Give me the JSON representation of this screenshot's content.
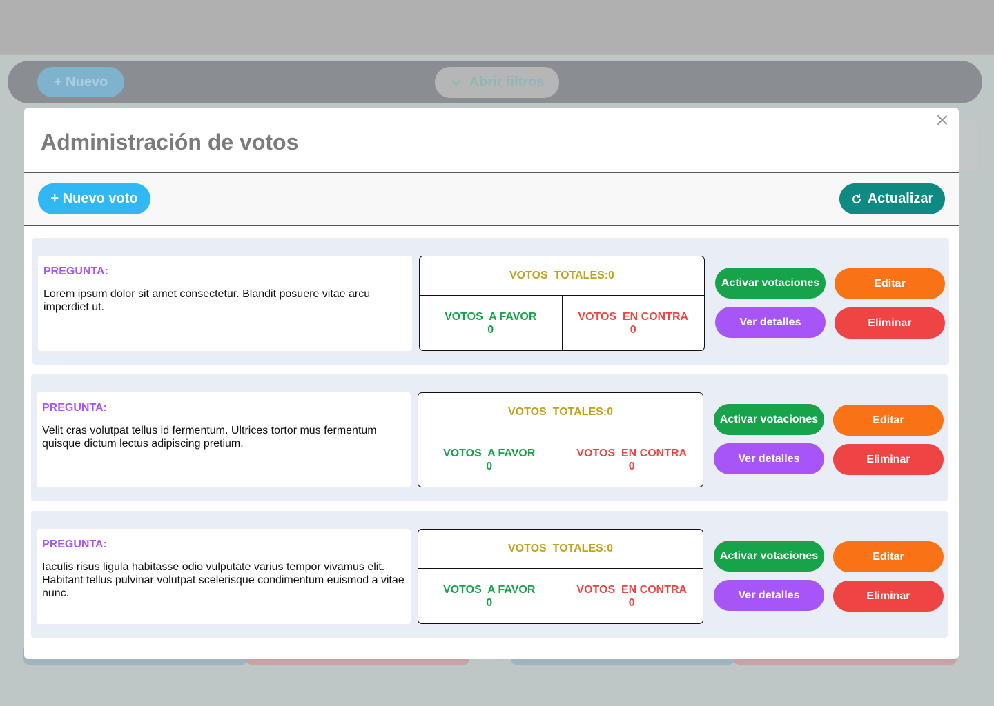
{
  "background": {
    "new_button_label": "+ Nuevo",
    "filters_button_label": "Abrir filtros"
  },
  "modal": {
    "title": "Administración de votos",
    "new_vote_label": "+ Nuevo voto",
    "refresh_label": "Actualizar"
  },
  "labels": {
    "question": "PREGUNTA:",
    "total_votes": "VOTOS  TOTALES:",
    "votes_for": "VOTOS  A FAVOR",
    "votes_against": "VOTOS  EN CONTRA",
    "activate": "Activar votaciones",
    "edit": "Editar",
    "details": "Ver detalles",
    "delete": "Eliminar"
  },
  "votes": [
    {
      "question": "Lorem ipsum dolor sit amet consectetur. Blandit posuere vitae arcu imperdiet ut.",
      "total": "0",
      "for": "0",
      "against": "0"
    },
    {
      "question": "Velit cras volutpat tellus id fermentum. Ultrices tortor mus fermentum quisque dictum lectus adipiscing pretium.",
      "total": "0",
      "for": "0",
      "against": "0"
    },
    {
      "question": "Iaculis risus ligula habitasse odio vulputate varius tempor vivamus elit. Habitant tellus pulvinar volutpat scelerisque condimentum euismod a vitae nunc.",
      "total": "0",
      "for": "0",
      "against": "0"
    }
  ],
  "icons": {
    "close": "close-icon",
    "refresh": "refresh-icon",
    "chevron": "chevron-down-icon"
  },
  "colors": {
    "new_vote": "#2fb8f4",
    "refresh": "#0f8a82",
    "question_label": "#a855f7",
    "total": "#c0a31c",
    "favor": "#16a34a",
    "contra": "#ef4444",
    "edit": "#f97316"
  }
}
